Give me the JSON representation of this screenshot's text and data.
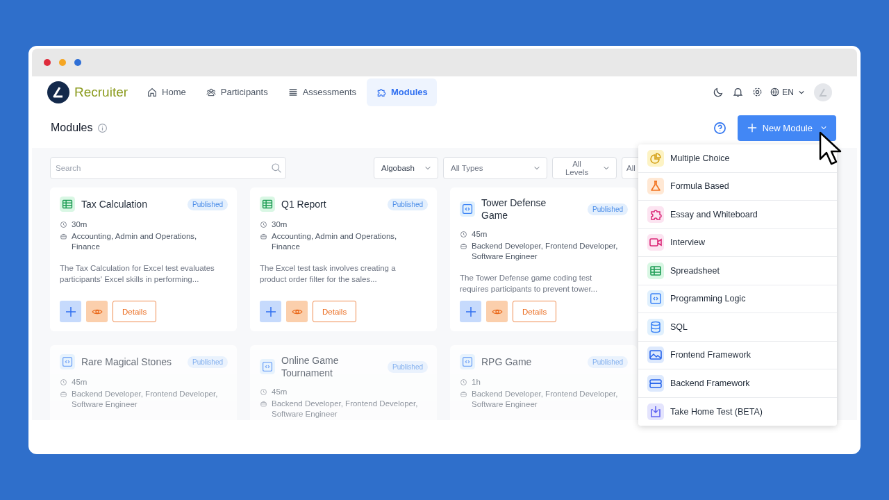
{
  "nav": {
    "brand": "Recruiter",
    "items": [
      {
        "label": "Home",
        "selected": false
      },
      {
        "label": "Participants",
        "selected": false
      },
      {
        "label": "Assessments",
        "selected": false
      },
      {
        "label": "Modules",
        "selected": true
      }
    ],
    "language": "EN"
  },
  "page": {
    "title": "Modules",
    "new_button": "New Module"
  },
  "search": {
    "placeholder": "Search"
  },
  "filters": [
    {
      "value": "Algobash"
    },
    {
      "value": "All Types"
    },
    {
      "value": "All Levels"
    },
    {
      "value": "All"
    }
  ],
  "cards": [
    {
      "title": "Tax Calculation",
      "kind": "spreadsheet",
      "status": "Published",
      "duration": "30m",
      "roles": "Accounting, Admin and Operations, Finance",
      "description": "The Tax Calculation for Excel test evaluates participants' Excel skills in performing...",
      "details": "Details"
    },
    {
      "title": "Q1 Report",
      "kind": "spreadsheet",
      "status": "Published",
      "duration": "30m",
      "roles": "Accounting, Admin and Operations, Finance",
      "description": "The Excel test task involves creating a product order filter for the sales...",
      "details": "Details"
    },
    {
      "title": "Tower Defense Game",
      "kind": "code",
      "status": "Published",
      "duration": "45m",
      "roles": "Backend Developer, Frontend Developer, Software Engineer",
      "description": "The Tower Defense game coding test requires participants to prevent tower...",
      "details": "Details"
    },
    {
      "title": "Rare Magical Stones",
      "kind": "code",
      "status": "Published",
      "duration": "45m",
      "roles": "Backend Developer, Frontend Developer, Software Engineer"
    },
    {
      "title": "Online Game Tournament",
      "kind": "code",
      "status": "Published",
      "duration": "45m",
      "roles": "Backend Developer, Frontend Developer, Software Engineer"
    },
    {
      "title": "RPG Game",
      "kind": "code",
      "status": "Published",
      "duration": "1h",
      "roles": "Backend Developer, Frontend Developer, Software Engineer"
    }
  ],
  "menu": [
    {
      "label": "Multiple Choice",
      "kind": "choice"
    },
    {
      "label": "Formula Based",
      "kind": "flask"
    },
    {
      "label": "Essay and Whiteboard",
      "kind": "puzzle"
    },
    {
      "label": "Interview",
      "kind": "video"
    },
    {
      "label": "Spreadsheet",
      "kind": "spreadsheet"
    },
    {
      "label": "Programming Logic",
      "kind": "code"
    },
    {
      "label": "SQL",
      "kind": "database"
    },
    {
      "label": "Frontend Framework",
      "kind": "image"
    },
    {
      "label": "Backend Framework",
      "kind": "server"
    },
    {
      "label": "Take Home Test (BETA)",
      "kind": "download"
    }
  ]
}
